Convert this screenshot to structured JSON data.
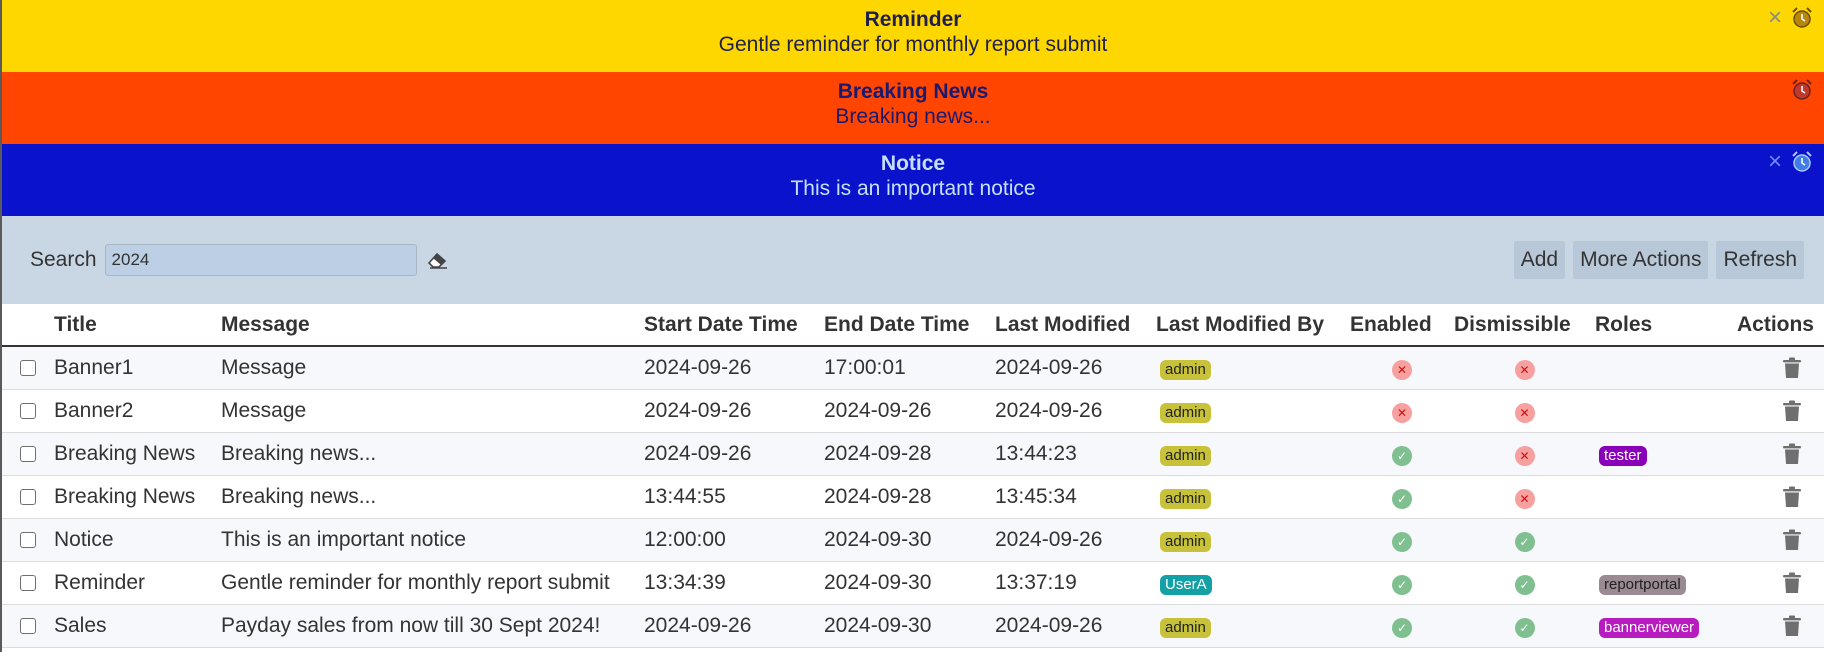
{
  "banners": [
    {
      "title": "Reminder",
      "message": "Gentle reminder for monthly report submit",
      "close": "×"
    },
    {
      "title": "Breaking News",
      "message": "Breaking news..."
    },
    {
      "title": "Notice",
      "message": "This is an important notice",
      "close": "×"
    }
  ],
  "toolbar": {
    "search_label": "Search",
    "search_value": "2024",
    "add_label": "Add",
    "more_actions_label": "More Actions",
    "refresh_label": "Refresh"
  },
  "table": {
    "headers": {
      "title": "Title",
      "message": "Message",
      "start": "Start Date Time",
      "end": "End Date Time",
      "modified": "Last Modified",
      "modified_by": "Last Modified By",
      "enabled": "Enabled",
      "dismissible": "Dismissible",
      "roles": "Roles",
      "actions": "Actions"
    },
    "rows": [
      {
        "title": "Banner1",
        "message": "Message",
        "start": "2024-09-26",
        "end": "17:00:01",
        "modified": "2024-09-26",
        "modified_by": "admin",
        "enabled": false,
        "dismissible": false,
        "role": ""
      },
      {
        "title": "Banner2",
        "message": "Message",
        "start": "2024-09-26",
        "end": "2024-09-26",
        "modified": "2024-09-26",
        "modified_by": "admin",
        "enabled": false,
        "dismissible": false,
        "role": ""
      },
      {
        "title": "Breaking News",
        "message": "Breaking news...",
        "start": "2024-09-26",
        "end": "2024-09-28",
        "modified": "13:44:23",
        "modified_by": "admin",
        "enabled": true,
        "dismissible": false,
        "role": "tester"
      },
      {
        "title": "Breaking News",
        "message": "Breaking news...",
        "start": "13:44:55",
        "end": "2024-09-28",
        "modified": "13:45:34",
        "modified_by": "admin",
        "enabled": true,
        "dismissible": false,
        "role": ""
      },
      {
        "title": "Notice",
        "message": "This is an important notice",
        "start": "12:00:00",
        "end": "2024-09-30",
        "modified": "2024-09-26",
        "modified_by": "admin",
        "enabled": true,
        "dismissible": true,
        "role": ""
      },
      {
        "title": "Reminder",
        "message": "Gentle reminder for monthly report submit",
        "start": "13:34:39",
        "end": "2024-09-30",
        "modified": "13:37:19",
        "modified_by": "UserA",
        "enabled": true,
        "dismissible": true,
        "role": "reportportal"
      },
      {
        "title": "Sales",
        "message": "Payday sales from now till 30 Sept 2024!",
        "start": "2024-09-26",
        "end": "2024-09-30",
        "modified": "2024-09-26",
        "modified_by": "admin",
        "enabled": true,
        "dismissible": true,
        "role": "bannerviewer"
      }
    ]
  },
  "icons": {
    "close": "close-icon",
    "alarm": "alarm-clock-icon",
    "eraser": "eraser-icon",
    "enabled_true": "check-circle-icon",
    "enabled_false": "x-circle-icon",
    "delete": "trash-icon"
  },
  "colors": {
    "banner_reminder": "#ffd700",
    "banner_breaking": "#ff4500",
    "banner_notice": "#0a12cc",
    "toolbar_bg": "#c9d6e4",
    "badge_admin": "#c7c23a",
    "badge_user": "#13a1a6",
    "role_tester": "#8a00b8",
    "role_reportportal": "#9a8a92",
    "role_bannerviewer": "#b81bbf"
  }
}
